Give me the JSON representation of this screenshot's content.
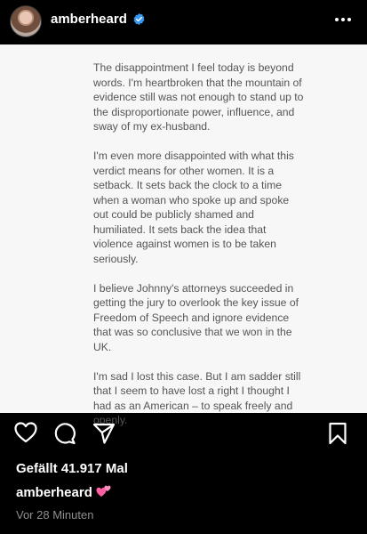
{
  "header": {
    "username": "amberheard",
    "avatar_icon": "profile-photo",
    "verified_icon": "verified-badge-icon",
    "more_icon": "more-options-icon"
  },
  "post": {
    "paragraphs": [
      "The disappointment I feel today is beyond words. I'm heartbroken that the mountain of evidence still was not enough to stand up to the disproportionate power, influence, and sway of my ex-husband.",
      "I'm even more disappointed with what this verdict means for other women. It is a setback. It sets back the clock to a time when a woman who spoke up and spoke out could be publicly shamed and humiliated. It sets back the idea that violence against women is to be taken seriously.",
      "I believe Johnny's attorneys succeeded in getting the jury to overlook the key issue of Freedom of Speech and ignore evidence that was so conclusive that we won in the UK.",
      "I'm sad I lost this case. But I am sadder still that I seem to have lost a right I thought I had as an American – to speak freely and openly."
    ]
  },
  "actions": {
    "like_icon": "heart-icon",
    "comment_icon": "comment-icon",
    "share_icon": "send-icon",
    "save_icon": "bookmark-icon"
  },
  "likes": "Gefällt 41.917 Mal",
  "caption": {
    "username": "amberheard",
    "emoji": "two-hearts-emoji"
  },
  "timestamp": "Vor 28 Minuten",
  "colors": {
    "background": "#000000",
    "post_background": "#f7f7f7",
    "post_text": "#555555",
    "verified": "#3897f0",
    "muted": "#8e8e8e",
    "emoji": "#ff5fa2"
  }
}
